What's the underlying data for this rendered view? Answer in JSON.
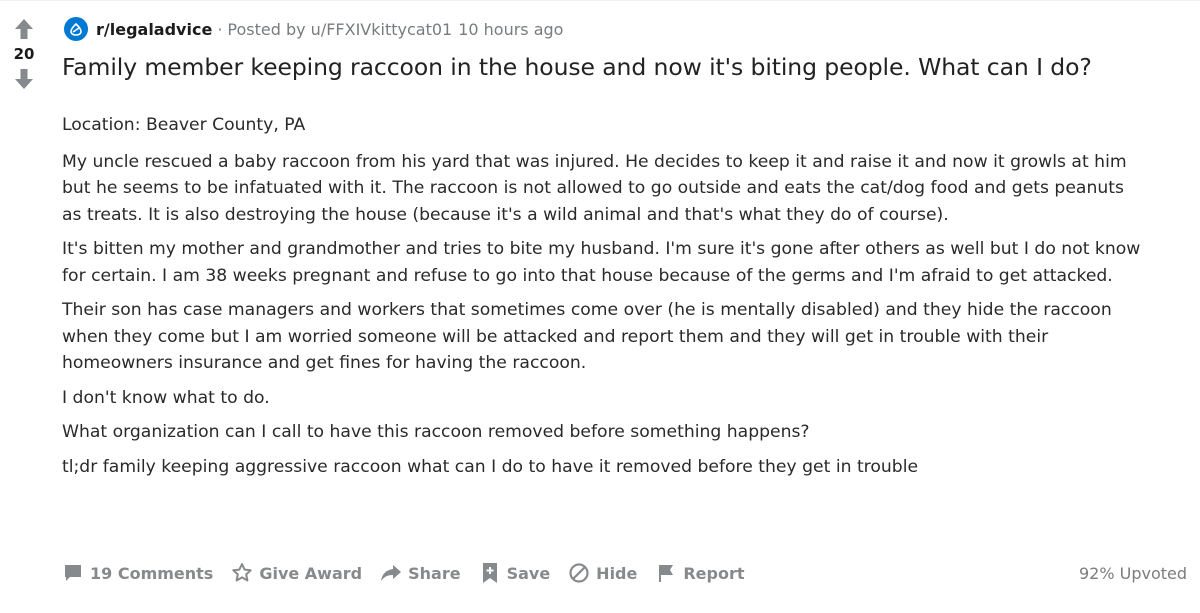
{
  "post": {
    "vote_count": "20",
    "subreddit": "r/legaladvice",
    "separator": "·",
    "posted_by": "Posted by u/FFXIVkittycat01",
    "time_ago": "10 hours ago",
    "title": "Family member keeping raccoon in the house and now it's biting people. What can I do?",
    "body": {
      "location": "Location: Beaver County, PA",
      "paragraphs": [
        "My uncle rescued a baby raccoon from his yard that was injured. He decides to keep it and raise it and now it growls at him but he seems to be infatuated with it. The raccoon is not allowed to go outside and eats the cat/dog food and gets peanuts as treats. It is also destroying the house (because it's a wild animal and that's what they do of course).",
        "It's bitten my mother and grandmother and tries to bite my husband. I'm sure it's gone after others as well but I do not know for certain. I am 38 weeks pregnant and refuse to go into that house because of the germs and I'm afraid to get attacked.",
        "Their son has case managers and workers that sometimes come over (he is mentally disabled) and they hide the raccoon when they come but I am worried someone will be attacked and report them and they will get in trouble with their homeowners insurance and get fines for having the raccoon.",
        "I don't know what to do.",
        "What organization can I call to have this raccoon removed before something happens?",
        "tl;dr family keeping aggressive raccoon what can I do to have it removed before they get in trouble"
      ]
    }
  },
  "footer": {
    "comments_label": "19 Comments",
    "award_label": "Give Award",
    "share_label": "Share",
    "save_label": "Save",
    "hide_label": "Hide",
    "report_label": "Report",
    "upvoted_label": "92% Upvoted"
  },
  "colors": {
    "subreddit_icon_bg": "#0079d3",
    "meta_text": "#787c7e",
    "action_text": "#878a8c",
    "vote_arrow": "#878a8c"
  },
  "icons": {
    "upvote": "arrow-up-icon",
    "downvote": "arrow-down-icon",
    "subreddit": "subreddit-scales-icon",
    "comments": "comment-bubble-icon",
    "award": "award-icon",
    "share": "share-arrow-icon",
    "save": "bookmark-plus-icon",
    "hide": "hide-circle-slash-icon",
    "report": "flag-icon"
  }
}
